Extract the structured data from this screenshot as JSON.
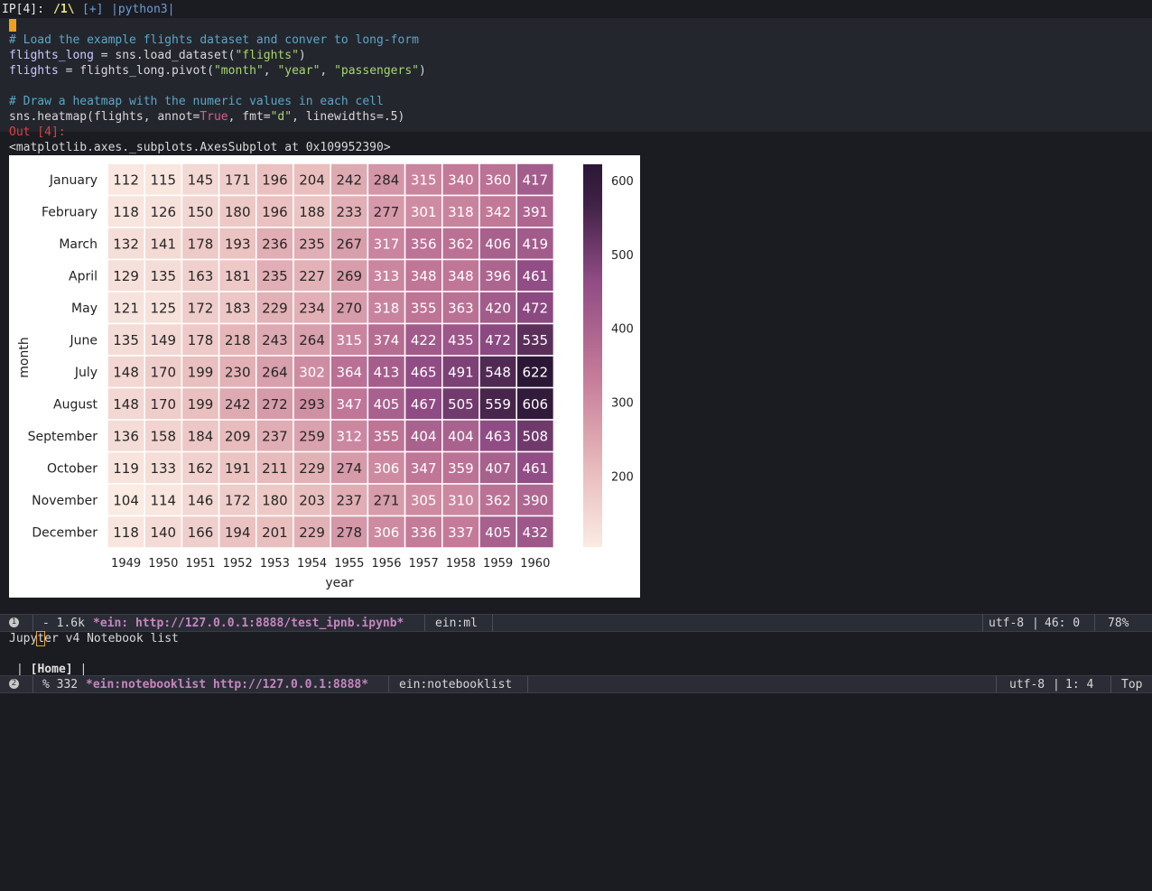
{
  "tabbar": {
    "prefix": "IP[4]:",
    "active_tab": "/1\\",
    "add_tab": "[+]",
    "kernel": "|python3|"
  },
  "code": {
    "line1": "# Load the example flights dataset and conver to long-form",
    "line2_var": "flights_long",
    "line2_rest": " = sns.load_dataset(",
    "line2_str": "\"flights\"",
    "line2_end": ")",
    "line3_var": "flights",
    "line3_rest": " = flights_long.pivot(",
    "line3_s1": "\"month\"",
    "line3_s2": "\"year\"",
    "line3_s3": "\"passengers\"",
    "line3_sep": ", ",
    "line3_end": ")",
    "line5": "# Draw a heatmap with the numeric values in each cell",
    "line6_a": "sns.heatmap(flights, annot=",
    "line6_kw": "True",
    "line6_b": ", fmt=",
    "line6_str": "\"d\"",
    "line6_c": ", linewidths=.5)"
  },
  "output": {
    "label": "Out [4]:",
    "repr": "<matplotlib.axes._subplots.AxesSubplot at 0x109952390>"
  },
  "chart_data": {
    "type": "heatmap",
    "xlabel": "year",
    "ylabel": "month",
    "x": [
      "1949",
      "1950",
      "1951",
      "1952",
      "1953",
      "1954",
      "1955",
      "1956",
      "1957",
      "1958",
      "1959",
      "1960"
    ],
    "y": [
      "January",
      "February",
      "March",
      "April",
      "May",
      "June",
      "July",
      "August",
      "September",
      "October",
      "November",
      "December"
    ],
    "values": [
      [
        112,
        115,
        145,
        171,
        196,
        204,
        242,
        284,
        315,
        340,
        360,
        417
      ],
      [
        118,
        126,
        150,
        180,
        196,
        188,
        233,
        277,
        301,
        318,
        342,
        391
      ],
      [
        132,
        141,
        178,
        193,
        236,
        235,
        267,
        317,
        356,
        362,
        406,
        419
      ],
      [
        129,
        135,
        163,
        181,
        235,
        227,
        269,
        313,
        348,
        348,
        396,
        461
      ],
      [
        121,
        125,
        172,
        183,
        229,
        234,
        270,
        318,
        355,
        363,
        420,
        472
      ],
      [
        135,
        149,
        178,
        218,
        243,
        264,
        315,
        374,
        422,
        435,
        472,
        535
      ],
      [
        148,
        170,
        199,
        230,
        264,
        302,
        364,
        413,
        465,
        491,
        548,
        622
      ],
      [
        148,
        170,
        199,
        242,
        272,
        293,
        347,
        405,
        467,
        505,
        559,
        606
      ],
      [
        136,
        158,
        184,
        209,
        237,
        259,
        312,
        355,
        404,
        404,
        463,
        508
      ],
      [
        119,
        133,
        162,
        191,
        211,
        229,
        274,
        306,
        347,
        359,
        407,
        461
      ],
      [
        104,
        114,
        146,
        172,
        180,
        203,
        237,
        271,
        305,
        310,
        362,
        390
      ],
      [
        118,
        140,
        166,
        194,
        201,
        229,
        278,
        306,
        336,
        337,
        405,
        432
      ]
    ],
    "colorbar_ticks": [
      200,
      300,
      400,
      500,
      600
    ],
    "vmin": 104,
    "vmax": 622,
    "colormap_colors": [
      "#faebe3",
      "#e8bcbc",
      "#c47a98",
      "#8f4b84",
      "#3f2145",
      "#2b1735"
    ]
  },
  "modeline1": {
    "num": "1",
    "status": "- 1.6k",
    "buffer": "*ein: http://127.0.0.1:8888/test_ipnb.ipynb*",
    "mode": "ein:ml",
    "encoding": "utf-8",
    "position": "46: 0",
    "percent": "78%"
  },
  "notebooklist": {
    "title_a": "Jupy",
    "title_cursor": "t",
    "title_b": "er v4 Notebook list",
    "home_line_a": "| ",
    "home": "[Home]",
    "home_line_b": " |"
  },
  "modeline2": {
    "num": "2",
    "status": "% 332",
    "buffer": "*ein:notebooklist http://127.0.0.1:8888*",
    "mode": "ein:notebooklist",
    "encoding": "utf-8",
    "position": "1: 4",
    "scroll": "Top"
  }
}
